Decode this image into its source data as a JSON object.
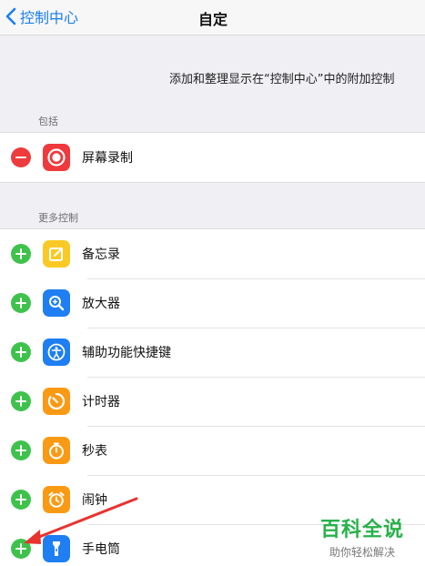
{
  "navbar": {
    "back_label": "控制中心",
    "title": "自定"
  },
  "description": "添加和整理显示在“控制中心”中的附加控制",
  "included": {
    "header": "包括",
    "items": [
      {
        "label": "屏幕录制",
        "action": "remove",
        "icon": "screen-record-icon",
        "icon_color": "#f0393c"
      }
    ]
  },
  "more": {
    "header": "更多控制",
    "items": [
      {
        "label": "备忘录",
        "action": "add",
        "icon": "notes-icon",
        "icon_color": "#fbc925"
      },
      {
        "label": "放大器",
        "action": "add",
        "icon": "magnifier-icon",
        "icon_color": "#1e7ef2"
      },
      {
        "label": "辅助功能快捷键",
        "action": "add",
        "icon": "accessibility-icon",
        "icon_color": "#1e7ef2"
      },
      {
        "label": "计时器",
        "action": "add",
        "icon": "timer-icon",
        "icon_color": "#fa9a14"
      },
      {
        "label": "秒表",
        "action": "add",
        "icon": "stopwatch-icon",
        "icon_color": "#fa9a14"
      },
      {
        "label": "闹钟",
        "action": "add",
        "icon": "alarm-icon",
        "icon_color": "#fa9a14"
      },
      {
        "label": "手电筒",
        "action": "add",
        "icon": "flashlight-icon",
        "icon_color": "#1e7ef2"
      }
    ]
  },
  "watermark": {
    "main": "百科全说",
    "sub": "助你轻松解决"
  },
  "colors": {
    "accent": "#1a7ef5",
    "add": "#3ec24c",
    "remove": "#ee3b3b",
    "arrow": "#e8332f"
  }
}
